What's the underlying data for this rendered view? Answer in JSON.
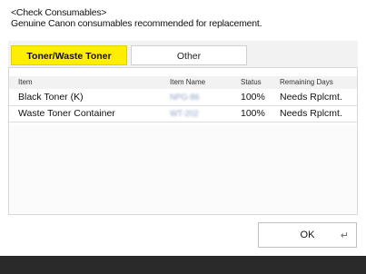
{
  "header": {
    "title": "<Check Consumables>",
    "subtitle": "Genuine Canon consumables recommended for replacement."
  },
  "tabs": [
    {
      "label": "Toner/Waste Toner",
      "selected": true
    },
    {
      "label": "Other",
      "selected": false
    }
  ],
  "table": {
    "columns": [
      "Item",
      "Item Name",
      "Status",
      "Remaining Days"
    ],
    "rows": [
      {
        "item": "Black Toner (K)",
        "item_name": "NPG-86",
        "status": "100%",
        "remaining_days": "Needs Rplcmt."
      },
      {
        "item": "Waste Toner Container",
        "item_name": "WT-202",
        "status": "100%",
        "remaining_days": "Needs Rplcmt."
      }
    ]
  },
  "footer": {
    "ok_label": "OK",
    "enter_icon": "enter-icon"
  },
  "colors": {
    "selected_tab": "#ffee00",
    "bottom_bar": "#2a2a2a"
  }
}
